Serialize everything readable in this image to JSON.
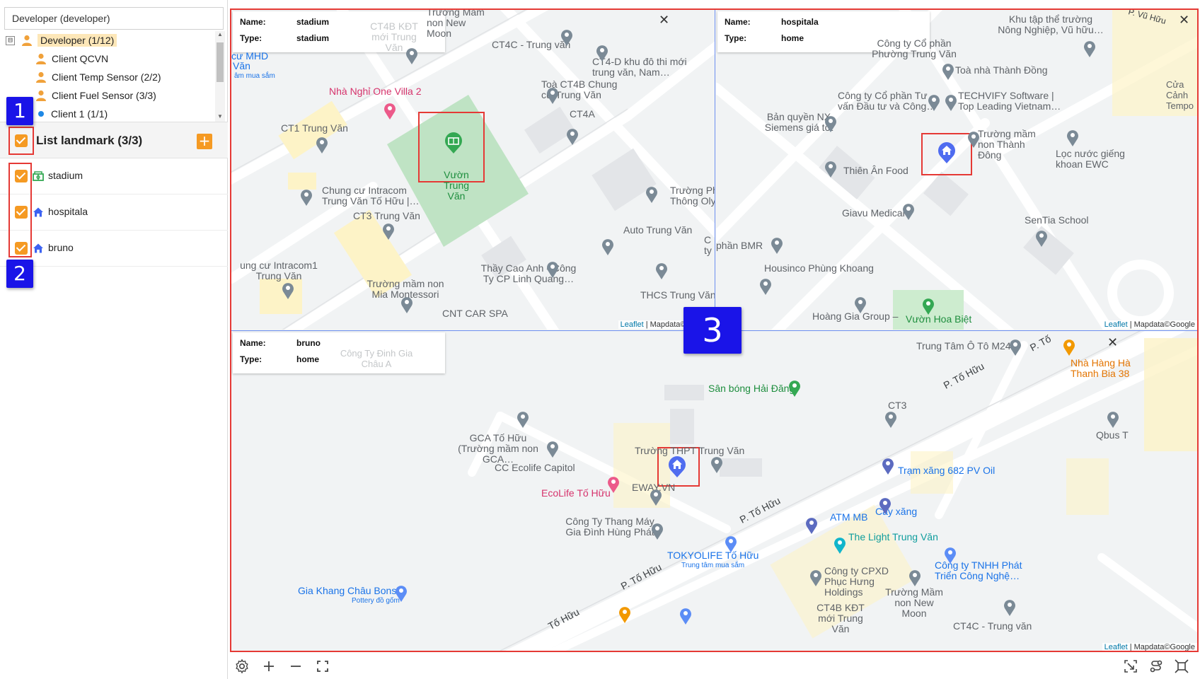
{
  "sidebar": {
    "tree_select_value": "Developer (developer)",
    "tree": [
      {
        "label": "Developer (1/12)",
        "toggle": "⊟"
      },
      {
        "label": "Client QCVN"
      },
      {
        "label": "Client Temp Sensor (2/2)"
      },
      {
        "label": "Client Fuel Sensor (3/3)"
      },
      {
        "label": "Client 1 (1/1)"
      }
    ],
    "landmark_title": "List landmark (3/3)",
    "add_label": "+",
    "landmarks": [
      {
        "label": "stadium"
      },
      {
        "label": "hospitala"
      },
      {
        "label": "bruno"
      }
    ]
  },
  "annotations": {
    "b1": "1",
    "b2": "2",
    "b3": "3"
  },
  "panels": {
    "stadium": {
      "name_key": "Name:",
      "name": "stadium",
      "type_key": "Type:",
      "type": "stadium",
      "close": "✕",
      "labels": [
        "CT4B KĐT mới Trung Văn",
        "Trường Mầm non New Moon",
        "CT4C - Trung văn",
        "CT4-D khu đô thi mới trung văn, Nam…",
        "Toà CT4B Chung cư Trung Văn",
        "CT4A",
        "cư MHD",
        "Văn",
        "âm mua sắm",
        "Nhà Nghỉ One Villa 2",
        "CT1 Trung Văn",
        "Vườn Trung Văn",
        "Chung cư Intracom Trung Văn Tố Hữu |…",
        "CT3 Trung Văn",
        "Trường Ph Thông Oly",
        "Auto Trung Văn",
        "ung cư Intracom1 Trung Văn",
        "Trường mầm non Mia Montessori",
        "Thầy Cao Anh - Công Ty CP Linh Quang…",
        "THCS Trung Văn",
        "CNT CAR SPA",
        "C ty"
      ]
    },
    "hospitala": {
      "name_key": "Name:",
      "name": "hospitala",
      "type_key": "Type:",
      "type": "home",
      "close": "✕",
      "labels": [
        "Khu tập thể trường Nông Nghiệp, Vũ hữu…",
        "P. Vũ Hữu",
        "Công ty Cổ phần Phường Trung Văn",
        "Toà nhà Thành Đồng",
        "Cửa Cảnh Tempo",
        "Công ty Cổ phần Tư vấn Đầu tư và Công…",
        "TECHVIFY Software | Top Leading Vietnam…",
        "Bản quyền NX Siemens giá tốt",
        "Trường mầm non Thành Đông",
        "Lọc nước giếng khoan EWC",
        "Thiên Ân Food",
        "Giavu Medical",
        "SenTia School",
        "phần BMR",
        "Housinco Phùng Khoang",
        "Hoàng Gia Group –",
        "Vườn Hoa Biệt"
      ]
    },
    "bruno": {
      "name_key": "Name:",
      "name": "bruno",
      "type_key": "Type:",
      "type": "home",
      "close": "✕",
      "labels": [
        "Công Ty Đinh Gia Châu A",
        "Trung Tâm Ô Tô M247",
        "P. Tố",
        "Nhà Hàng Hà Thanh Bia 38",
        "Sân bóng Hải Đăng",
        "P. Tố Hữu",
        "CT3",
        "Qbus T",
        "GCA Tố Hữu (Trường mầm non GCA…",
        "CC Ecolife Capitol",
        "Trường THPT Trung Văn",
        "Trạm xăng 682 PV Oil",
        "EcoLife Tố Hữu",
        "EWAY.VN",
        "Cây xăng",
        "P. Tố Hữu",
        "ATM MB",
        "Công Ty Thang Máy Gia Đình Hùng Phát",
        "The Light Trung Văn",
        "TOKYOLIFE Tố Hữu",
        "Trung tâm mua sắm",
        "Công ty TNHH Phát Triển Công Nghệ…",
        "Công ty CPXD Phục Hưng Holdings",
        "P. Tố Hữu",
        "Gia Khang Châu Bonsai",
        "Pottery đồ gốm",
        "Trường Mầm non New Moon",
        "CT4B KĐT mới Trung Văn",
        "Tố Hữu",
        "CT4C - Trung văn"
      ]
    },
    "attribution_leaflet": "Leaflet",
    "attribution_rest": " | Mapdata©Google"
  },
  "toolbar": [
    "gear-icon",
    "plus-icon",
    "minus-icon",
    "fullscreen-icon",
    "crop-icon",
    "route-icon",
    "expand-icon"
  ],
  "colors": {
    "accent": "#f59a23",
    "annotation_red": "#e53935",
    "badge_blue": "#1a14e8",
    "marker_blue": "#4f6cf0",
    "marker_green": "#34a853"
  }
}
